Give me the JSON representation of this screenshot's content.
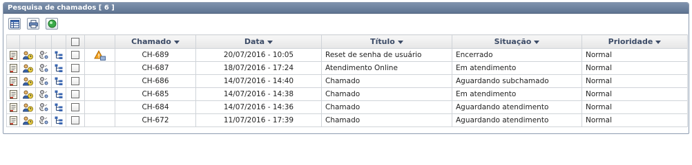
{
  "panel": {
    "title": "Pesquisa de chamados [ 6 ]"
  },
  "toolbar": {
    "buttons": [
      "grid-view-icon",
      "print-icon",
      "export-icon"
    ]
  },
  "columns": {
    "chamado": "Chamado",
    "data": "Data",
    "titulo": "Título",
    "situacao": "Situação",
    "prioridade": "Prioridade"
  },
  "rows": [
    {
      "chamado": "CH-689",
      "data": "20/07/2016 - 10:05",
      "titulo": "Reset de senha de usuário",
      "situacao": "Encerrado",
      "prioridade": "Normal",
      "flag": "warning-icon"
    },
    {
      "chamado": "CH-687",
      "data": "18/07/2016 - 17:24",
      "titulo": "Atendimento Online",
      "situacao": "Em atendimento",
      "prioridade": "Normal"
    },
    {
      "chamado": "CH-686",
      "data": "14/07/2016 - 14:40",
      "titulo": "Chamado",
      "situacao": "Aguardando subchamado",
      "prioridade": "Normal"
    },
    {
      "chamado": "CH-685",
      "data": "14/07/2016 - 14:38",
      "titulo": "Chamado",
      "situacao": "Em atendimento",
      "prioridade": "Normal"
    },
    {
      "chamado": "CH-684",
      "data": "14/07/2016 - 14:36",
      "titulo": "Chamado",
      "situacao": "Aguardando atendimento",
      "prioridade": "Normal"
    },
    {
      "chamado": "CH-672",
      "data": "11/07/2016 - 17:39",
      "titulo": "Chamado",
      "situacao": "Aguardando atendimento",
      "prioridade": "Normal"
    }
  ],
  "colors": {
    "header": "#6b7f9b",
    "column_text": "#3c4b66",
    "border": "#cfd3d8"
  }
}
